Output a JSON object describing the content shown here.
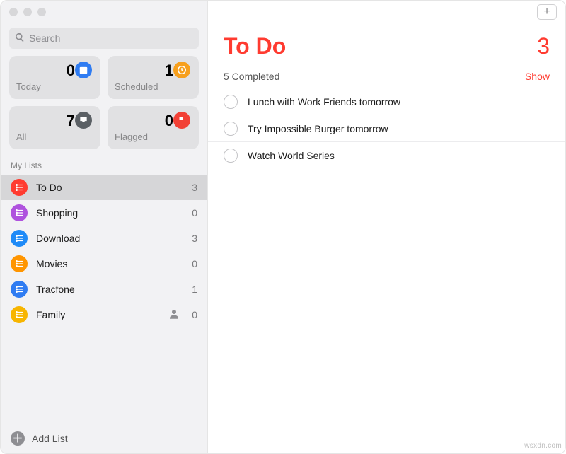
{
  "search": {
    "placeholder": "Search"
  },
  "smart": {
    "today": {
      "label": "Today",
      "count": 0,
      "color": "#2f7cf2"
    },
    "scheduled": {
      "label": "Scheduled",
      "count": 1,
      "color": "#f7a01e"
    },
    "all": {
      "label": "All",
      "count": 7,
      "color": "#5b6065"
    },
    "flagged": {
      "label": "Flagged",
      "count": 0,
      "color": "#f24136"
    }
  },
  "sectionLabel": "My Lists",
  "lists": [
    {
      "name": "To Do",
      "count": 3,
      "color": "#ff3b30",
      "selected": true,
      "shared": false
    },
    {
      "name": "Shopping",
      "count": 0,
      "color": "#af52de",
      "selected": false,
      "shared": false
    },
    {
      "name": "Download",
      "count": 3,
      "color": "#1e8af7",
      "selected": false,
      "shared": false
    },
    {
      "name": "Movies",
      "count": 0,
      "color": "#ff9500",
      "selected": false,
      "shared": false
    },
    {
      "name": "Tracfone",
      "count": 1,
      "color": "#2f7cf2",
      "selected": false,
      "shared": false
    },
    {
      "name": "Family",
      "count": 0,
      "color": "#f7b500",
      "selected": false,
      "shared": true
    }
  ],
  "footer": {
    "addList": "Add List"
  },
  "main": {
    "title": "To Do",
    "count": 3,
    "completedLabel": "5 Completed",
    "showLabel": "Show",
    "items": [
      {
        "text": "Lunch with Work Friends tomorrow"
      },
      {
        "text": "Try Impossible Burger tomorrow"
      },
      {
        "text": "Watch World Series"
      }
    ]
  },
  "watermark": "wsxdn.com"
}
